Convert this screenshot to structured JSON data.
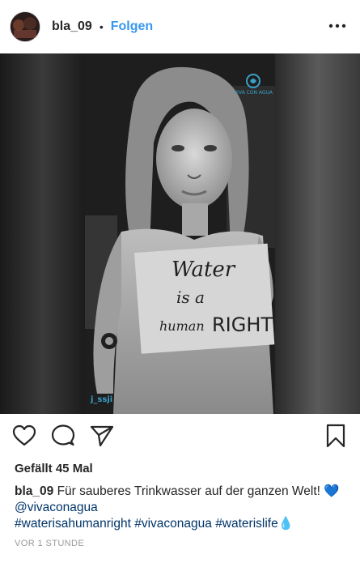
{
  "header": {
    "username": "bla_09",
    "separator": "•",
    "follow_label": "Folgen"
  },
  "post": {
    "sign": {
      "line1": "Water",
      "line2": "is a",
      "line3a": "human",
      "line3b": "RIGHT"
    },
    "logo_text": "VIVA CON AGUA",
    "watermark": "j_ssji"
  },
  "icons": {
    "like": "heart-icon",
    "comment": "comment-icon",
    "share": "paper-plane-icon",
    "save": "bookmark-icon",
    "more": "more-options-icon"
  },
  "likes": {
    "text": "Gefällt 45 Mal"
  },
  "caption": {
    "username": "bla_09",
    "text": "Für sauberes Trinkwasser auf der ganzen Welt!",
    "emoji": "💙",
    "mention": "@vivaconagua",
    "hashtags": [
      "#waterisahumanright",
      "#vivaconagua",
      "#waterislife"
    ],
    "drop": "💧"
  },
  "timestamp": "VOR 1 STUNDE"
}
